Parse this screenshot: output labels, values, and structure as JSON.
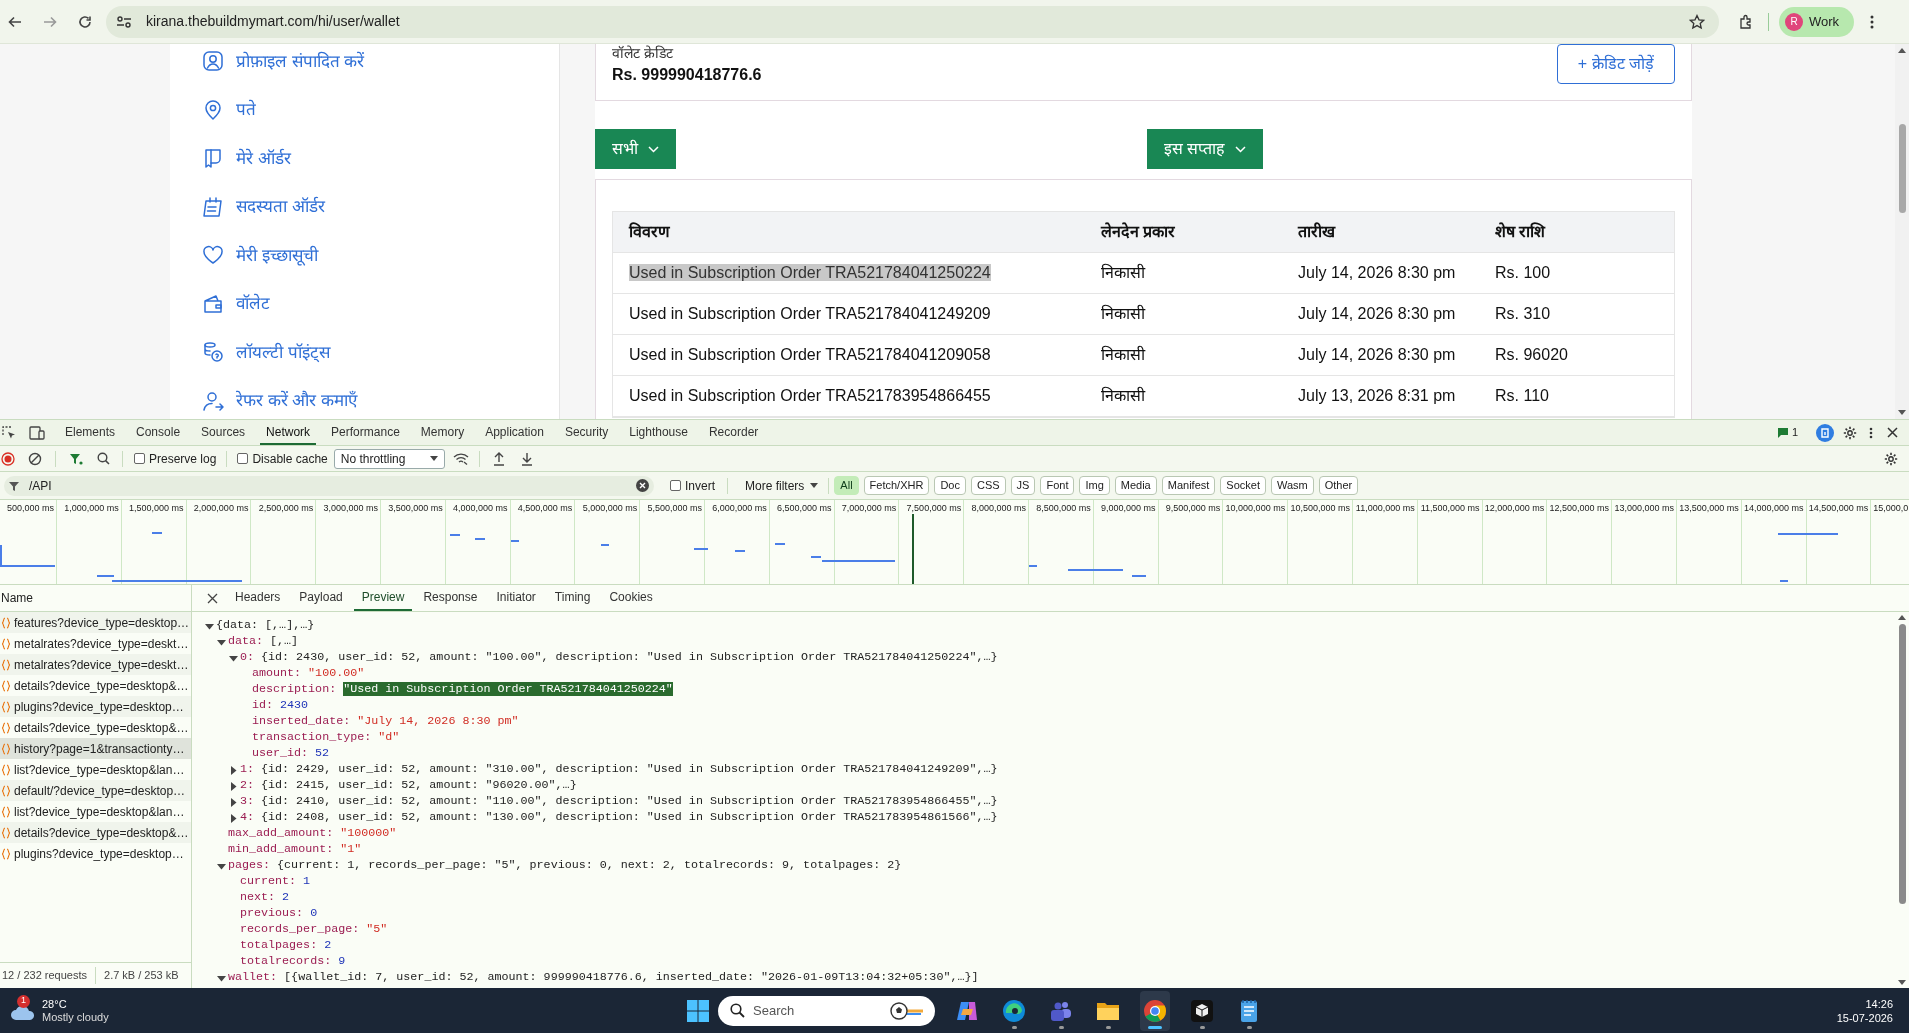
{
  "browser": {
    "url": "kirana.thebuildmymart.com/hi/user/wallet",
    "profile": {
      "initial": "R",
      "label": "Work"
    }
  },
  "sidebar": {
    "items": [
      {
        "label": "प्रोफ़ाइल संपादित करें"
      },
      {
        "label": "पते"
      },
      {
        "label": "मेरे ऑर्डर"
      },
      {
        "label": "सदस्यता ऑर्डर"
      },
      {
        "label": "मेरी इच्छासूची"
      },
      {
        "label": "वॉलेट"
      },
      {
        "label": "लॉयल्टी पॉइंट्स"
      },
      {
        "label": "रेफर करें और कमाएँ"
      }
    ]
  },
  "wallet": {
    "label": "वॉलेट क्रेडिट",
    "balance": "Rs. 999990418776.6",
    "add_button": "+ क्रेडिट जोड़ें"
  },
  "filters": [
    {
      "label": "सभी"
    },
    {
      "label": "इस सप्ताह"
    }
  ],
  "table": {
    "columns": [
      "विवरण",
      "लेनदेन प्रकार",
      "तारीख",
      "शेष राशि"
    ],
    "rows": [
      {
        "highlighted": true,
        "cells": [
          "Used in Subscription Order TRA521784041250224",
          "निकासी",
          "July 14, 2026 8:30 pm",
          "Rs. 100"
        ]
      },
      {
        "highlighted": false,
        "cells": [
          "Used in Subscription Order TRA521784041249209",
          "निकासी",
          "July 14, 2026 8:30 pm",
          "Rs. 310"
        ]
      },
      {
        "highlighted": false,
        "cells": [
          "Used in Subscription Order TRA521784041209058",
          "निकासी",
          "July 14, 2026 8:30 pm",
          "Rs. 96020"
        ]
      },
      {
        "highlighted": false,
        "cells": [
          "Used in Subscription Order TRA521783954866455",
          "निकासी",
          "July 13, 2026 8:31 pm",
          "Rs. 110"
        ]
      }
    ]
  },
  "devtools": {
    "tabs": [
      {
        "label": "Elements",
        "selected": false
      },
      {
        "label": "Console",
        "selected": false
      },
      {
        "label": "Sources",
        "selected": false
      },
      {
        "label": "Network",
        "selected": true
      },
      {
        "label": "Performance",
        "selected": false
      },
      {
        "label": "Memory",
        "selected": false
      },
      {
        "label": "Application",
        "selected": false
      },
      {
        "label": "Security",
        "selected": false
      },
      {
        "label": "Lighthouse",
        "selected": false
      },
      {
        "label": "Recorder",
        "selected": false
      }
    ],
    "issues_count": "1",
    "preserve_log": {
      "label": "Preserve log",
      "checked": false
    },
    "disable_cache": {
      "label": "Disable cache",
      "checked": false
    },
    "throttling": "No throttling",
    "filter_text": "/API",
    "invert": {
      "label": "Invert",
      "checked": false
    },
    "more_filters": "More filters",
    "type_filters": [
      {
        "label": "All",
        "selected": true
      },
      {
        "label": "Fetch/XHR",
        "selected": false
      },
      {
        "label": "Doc",
        "selected": false
      },
      {
        "label": "CSS",
        "selected": false
      },
      {
        "label": "JS",
        "selected": false
      },
      {
        "label": "Font",
        "selected": false
      },
      {
        "label": "Img",
        "selected": false
      },
      {
        "label": "Media",
        "selected": false
      },
      {
        "label": "Manifest",
        "selected": false
      },
      {
        "label": "Socket",
        "selected": false
      },
      {
        "label": "Wasm",
        "selected": false
      },
      {
        "label": "Other",
        "selected": false
      }
    ],
    "timeline_ticks": [
      "500,000 ms",
      "1,000,000 ms",
      "1,500,000 ms",
      "2,000,000 ms",
      "2,500,000 ms",
      "3,000,000 ms",
      "3,500,000 ms",
      "4,000,000 ms",
      "4,500,000 ms",
      "5,000,000 ms",
      "5,500,000 ms",
      "6,000,000 ms",
      "6,500,000 ms",
      "7,000,000 ms",
      "7,500,000 ms",
      "8,000,000 ms",
      "8,500,000 ms",
      "9,000,000 ms",
      "9,500,000 ms",
      "10,000,000 ms",
      "10,500,000 ms",
      "11,000,000 ms",
      "11,500,000 ms",
      "12,000,000 ms",
      "12,500,000 ms",
      "13,000,000 ms",
      "13,500,000 ms",
      "14,000,000 ms",
      "14,500,000 ms",
      "15,000,0"
    ],
    "name_header": "Name",
    "requests": [
      {
        "name": "features?device_type=desktop…",
        "selected": false
      },
      {
        "name": "metalrates?device_type=deskt…",
        "selected": false
      },
      {
        "name": "metalrates?device_type=deskt…",
        "selected": false
      },
      {
        "name": "details?device_type=desktop&…",
        "selected": false
      },
      {
        "name": "plugins?device_type=desktop…",
        "selected": false
      },
      {
        "name": "details?device_type=desktop&…",
        "selected": false
      },
      {
        "name": "history?page=1&transactionty…",
        "selected": true
      },
      {
        "name": "list?device_type=desktop&lan…",
        "selected": false
      },
      {
        "name": "default/?device_type=desktop…",
        "selected": false
      },
      {
        "name": "list?device_type=desktop&lan…",
        "selected": false
      },
      {
        "name": "details?device_type=desktop&…",
        "selected": false
      },
      {
        "name": "plugins?device_type=desktop…",
        "selected": false
      }
    ],
    "detail_tabs": [
      {
        "label": "Headers",
        "selected": false
      },
      {
        "label": "Payload",
        "selected": false
      },
      {
        "label": "Preview",
        "selected": true
      },
      {
        "label": "Response",
        "selected": false
      },
      {
        "label": "Initiator",
        "selected": false
      },
      {
        "label": "Timing",
        "selected": false
      },
      {
        "label": "Cookies",
        "selected": false
      }
    ],
    "preview": {
      "summary": "{data: [,…],…}",
      "expanded": true,
      "selected": false,
      "children": [
        {
          "key": "data:",
          "summary": "[,…]",
          "expanded": true,
          "selected": false,
          "children": [
            {
              "key": "0:",
              "summary": "{id: 2430, user_id: 52, amount: \"100.00\", description: \"Used in Subscription Order TRA521784041250224\",…}",
              "expanded": true,
              "selected": false,
              "children": [
                {
                  "key": "amount:",
                  "value": "\"100.00\"",
                  "kind": "string",
                  "selected": false
                },
                {
                  "key": "description:",
                  "value": "\"Used in Subscription Order TRA521784041250224\"",
                  "kind": "string",
                  "selected": true
                },
                {
                  "key": "id:",
                  "value": "2430",
                  "kind": "number",
                  "selected": false
                },
                {
                  "key": "inserted_date:",
                  "value": "\"July 14, 2026 8:30 pm\"",
                  "kind": "string",
                  "selected": false
                },
                {
                  "key": "transaction_type:",
                  "value": "\"d\"",
                  "kind": "string",
                  "selected": false
                },
                {
                  "key": "user_id:",
                  "value": "52",
                  "kind": "number",
                  "selected": false
                }
              ]
            },
            {
              "key": "1:",
              "summary": "{id: 2429, user_id: 52, amount: \"310.00\", description: \"Used in Subscription Order TRA521784041249209\",…}",
              "expanded": false,
              "selected": false
            },
            {
              "key": "2:",
              "summary": "{id: 2415, user_id: 52, amount: \"96020.00\",…}",
              "expanded": false,
              "selected": false
            },
            {
              "key": "3:",
              "summary": "{id: 2410, user_id: 52, amount: \"110.00\", description: \"Used in Subscription Order TRA521783954866455\",…}",
              "expanded": false,
              "selected": false
            },
            {
              "key": "4:",
              "summary": "{id: 2408, user_id: 52, amount: \"130.00\", description: \"Used in Subscription Order TRA521783954861566\",…}",
              "expanded": false,
              "selected": false
            }
          ]
        },
        {
          "key": "max_add_amount:",
          "value": "\"100000\"",
          "kind": "string",
          "selected": false
        },
        {
          "key": "min_add_amount:",
          "value": "\"1\"",
          "kind": "string",
          "selected": false
        },
        {
          "key": "pages:",
          "summary": "{current: 1, records_per_page: \"5\", previous: 0, next: 2, totalrecords: 9, totalpages: 2}",
          "expanded": true,
          "selected": false,
          "children": [
            {
              "key": "current:",
              "value": "1",
              "kind": "number",
              "selected": false
            },
            {
              "key": "next:",
              "value": "2",
              "kind": "number",
              "selected": false
            },
            {
              "key": "previous:",
              "value": "0",
              "kind": "number",
              "selected": false
            },
            {
              "key": "records_per_page:",
              "value": "\"5\"",
              "kind": "string",
              "selected": false
            },
            {
              "key": "totalpages:",
              "value": "2",
              "kind": "number",
              "selected": false
            },
            {
              "key": "totalrecords:",
              "value": "9",
              "kind": "number",
              "selected": false
            }
          ]
        },
        {
          "key": "wallet:",
          "summary": "[{wallet_id: 7, user_id: 52, amount: 999990418776.6, inserted_date: \"2026-01-09T13:04:32+05:30\",…}]",
          "expanded": true,
          "selected": false
        }
      ]
    },
    "status": [
      "12 / 232 requests",
      "2.7 kB / 253 kB"
    ]
  },
  "taskbar": {
    "weather": {
      "badge": "1",
      "temperature": "28°C",
      "condition": "Mostly cloudy"
    },
    "search": {
      "placeholder": "Search"
    },
    "time": "14:26",
    "date": "15-07-2026"
  }
}
